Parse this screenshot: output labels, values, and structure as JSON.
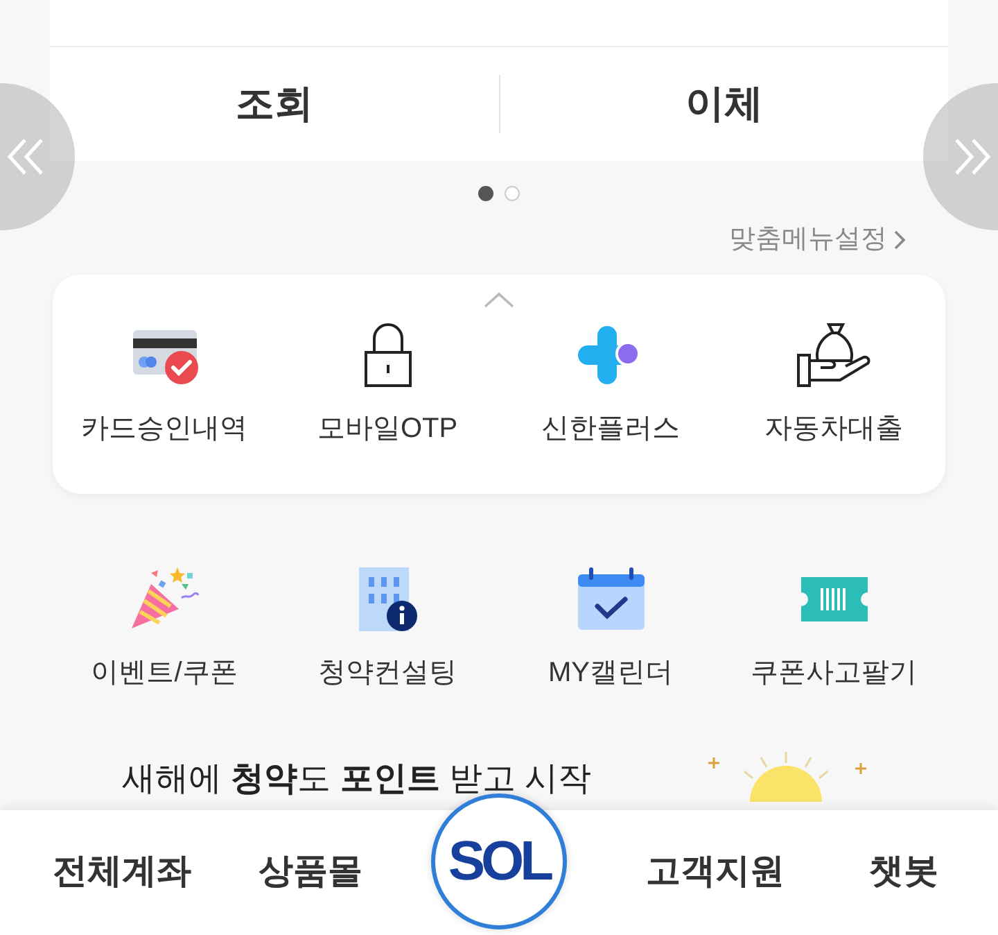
{
  "account_card": {
    "tabs": [
      {
        "label": "조회"
      },
      {
        "label": "이체"
      }
    ]
  },
  "pager": {
    "dots": [
      {
        "selected": true
      },
      {
        "selected": false
      }
    ]
  },
  "customize_link": "맞춤메뉴설정",
  "quick_menu": {
    "expanded": true,
    "items": [
      {
        "label": "카드승인내역",
        "kind": "card"
      },
      {
        "label": "모바일OTP",
        "kind": "lock"
      },
      {
        "label": "신한플러스",
        "kind": "plus"
      },
      {
        "label": "자동차대출",
        "kind": "moneybag"
      }
    ]
  },
  "shortcuts": [
    {
      "label": "이벤트/쿠폰",
      "kind": "party"
    },
    {
      "label": "청약컨설팅",
      "kind": "building"
    },
    {
      "label": "MY캘린더",
      "kind": "calendar"
    },
    {
      "label": "쿠폰사고팔기",
      "kind": "ticket"
    }
  ],
  "banner": {
    "text": "새해에 **청약**도 **포인트** 받고 시작"
  },
  "bottom_nav": [
    {
      "kind": "text",
      "label": "전체계좌"
    },
    {
      "kind": "text",
      "label": "상품몰"
    },
    {
      "kind": "logo",
      "label": "SOL"
    },
    {
      "kind": "text",
      "label": "고객지원"
    },
    {
      "kind": "text",
      "label": "챗봇"
    }
  ]
}
